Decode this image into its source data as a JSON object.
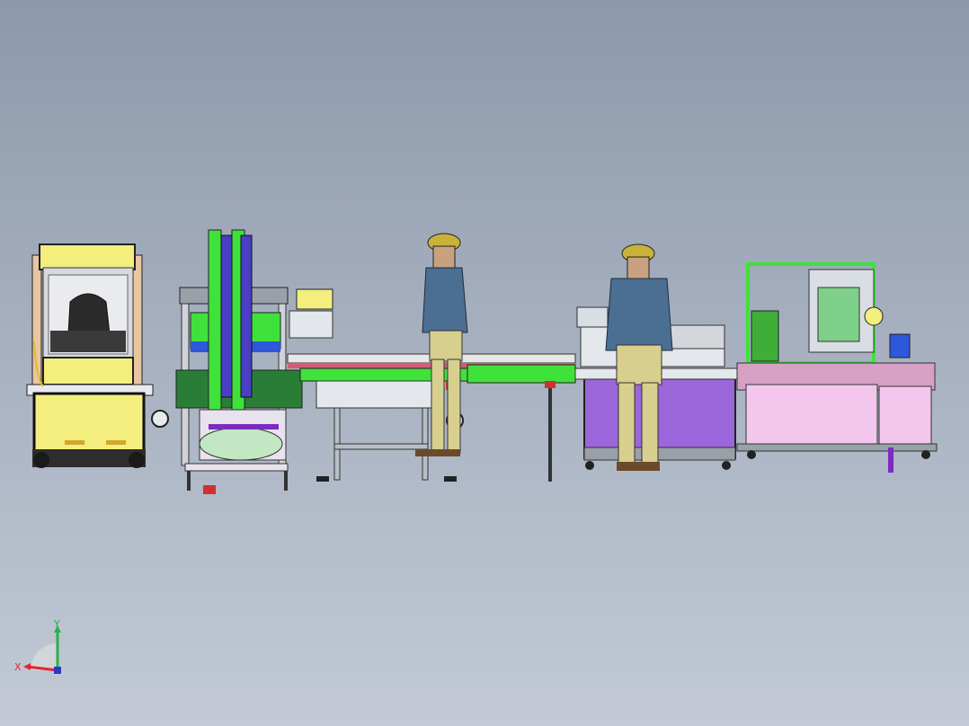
{
  "scene": {
    "colors": {
      "bg_top": "#8d99ab",
      "bg_bottom": "#c3cad6",
      "yellow": "#f3ee7e",
      "green": "#3fe23b",
      "purple": "#9a66d9",
      "pink": "#f3c6ee",
      "steel": "#d9dde4",
      "worker_jacket": "#4b6f93",
      "helmet": "#c9b23a",
      "trousers": "#d8cf8e"
    }
  },
  "triad": {
    "x_label": "X",
    "y_label": "Y",
    "x_color": "#e3262b",
    "y_color": "#27b14a",
    "z_color": "#2b39c9"
  }
}
